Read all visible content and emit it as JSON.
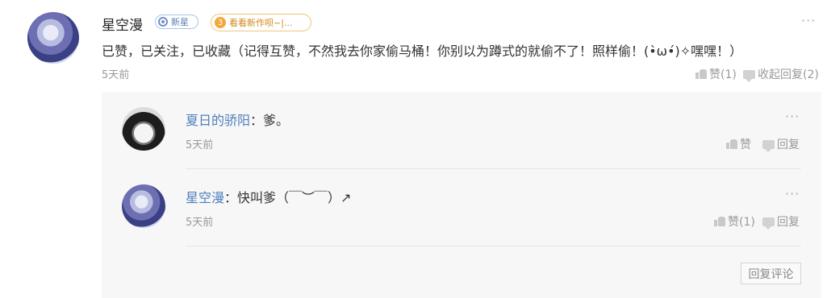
{
  "comment": {
    "username": "星空漫",
    "badge_new": "新星",
    "badge_level_num": "3",
    "badge_level_text": "看看新作呗~|...",
    "text": "已赞，已关注，已收藏（记得互赞，不然我去你家偷马桶！你别以为蹲式的就偷不了！照样偷！(•̀ω•́)✧嘿嘿！）",
    "time": "5天前",
    "more": "···",
    "like_label": "赞(1)",
    "collapse_label": "收起回复(2)"
  },
  "replies": [
    {
      "name": "夏日的骄阳",
      "separator": "：",
      "text": "爹。",
      "time": "5天前",
      "more": "···",
      "like_label": "赞",
      "reply_label": "回复"
    },
    {
      "name": "星空漫",
      "separator": "：",
      "text": "快叫爹（￣︶￣）↗",
      "time": "5天前",
      "more": "···",
      "like_label": "赞(1)",
      "reply_label": "回复"
    }
  ],
  "reply_comment_button": "回复评论",
  "icons": {
    "thumb": "thumbs-up-icon",
    "chat": "chat-bubble-icon",
    "more": "more-options-icon"
  },
  "colors": {
    "link_blue": "#4d7fbd",
    "muted": "#999999",
    "reply_bg": "#f7f7f7"
  }
}
